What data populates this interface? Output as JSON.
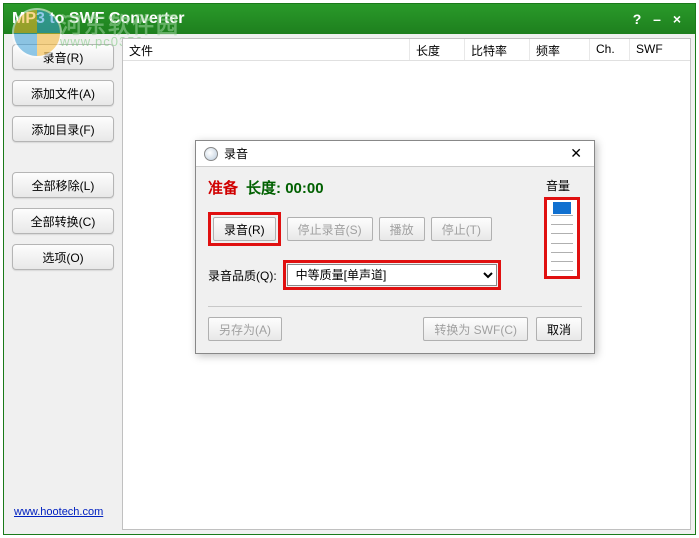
{
  "app": {
    "title": "MP3 to SWF Converter",
    "help": "?",
    "min": "–",
    "close": "×"
  },
  "watermark": {
    "name": "河东软件园",
    "url": "www.pc0359.cn"
  },
  "sidebar": {
    "record": "录音(R)",
    "add_file": "添加文件(A)",
    "add_dir": "添加目录(F)",
    "remove_all": "全部移除(L)",
    "convert_all": "全部转换(C)",
    "options": "选项(O)"
  },
  "footer": {
    "link": "www.hootech.com"
  },
  "columns": {
    "file": "文件",
    "length": "长度",
    "bitrate": "比特率",
    "freq": "频率",
    "ch": "Ch.",
    "swf": "SWF"
  },
  "dialog": {
    "title": "录音",
    "status": "准备",
    "length_label": "长度:",
    "length_value": "00:00",
    "volume_label": "音量",
    "btn_record": "录音(R)",
    "btn_stop_rec": "停止录音(S)",
    "btn_play": "播放",
    "btn_stop": "停止(T)",
    "quality_label": "录音品质(Q):",
    "quality_value": "中等质量[单声道]",
    "btn_save_as": "另存为(A)",
    "btn_to_swf": "转换为 SWF(C)",
    "btn_cancel": "取消",
    "close": "✕"
  }
}
